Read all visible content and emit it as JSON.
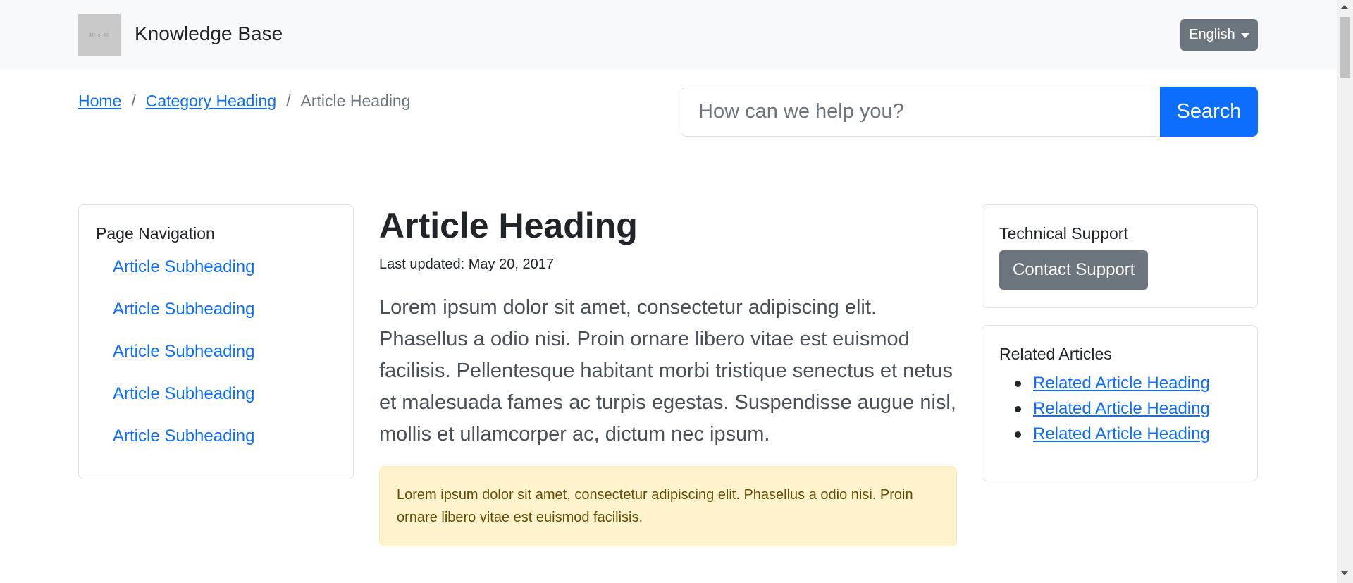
{
  "header": {
    "logo_text": "40 x 40",
    "brand": "Knowledge Base",
    "language": "English"
  },
  "breadcrumb": {
    "items": [
      "Home",
      "Category Heading",
      "Article Heading"
    ],
    "separator": "/"
  },
  "search": {
    "placeholder": "How can we help you?",
    "button": "Search"
  },
  "page_nav": {
    "title": "Page Navigation",
    "items": [
      "Article Subheading",
      "Article Subheading",
      "Article Subheading",
      "Article Subheading",
      "Article Subheading"
    ]
  },
  "article": {
    "title": "Article Heading",
    "updated": "Last updated: May 20, 2017",
    "lead": "Lorem ipsum dolor sit amet, consectetur adipiscing elit. Phasellus a odio nisi. Proin ornare libero vitae est euismod facilisis. Pellentesque habitant morbi tristique senectus et netus et malesuada fames ac turpis egestas. Suspendisse augue nisl, mollis et ullamcorper ac, dictum nec ipsum.",
    "alert": "Lorem ipsum dolor sit amet, consectetur adipiscing elit. Phasellus a odio nisi. Proin ornare libero vitae est euismod facilisis."
  },
  "support": {
    "title": "Technical Support",
    "button": "Contact Support"
  },
  "related": {
    "title": "Related Articles",
    "items": [
      "Related Article Heading",
      "Related Article Heading",
      "Related Article Heading"
    ]
  },
  "colors": {
    "primary": "#0d6efd",
    "secondary": "#6c757d",
    "navbar_bg": "#f8f9fa",
    "alert_bg": "#fff3cd"
  }
}
